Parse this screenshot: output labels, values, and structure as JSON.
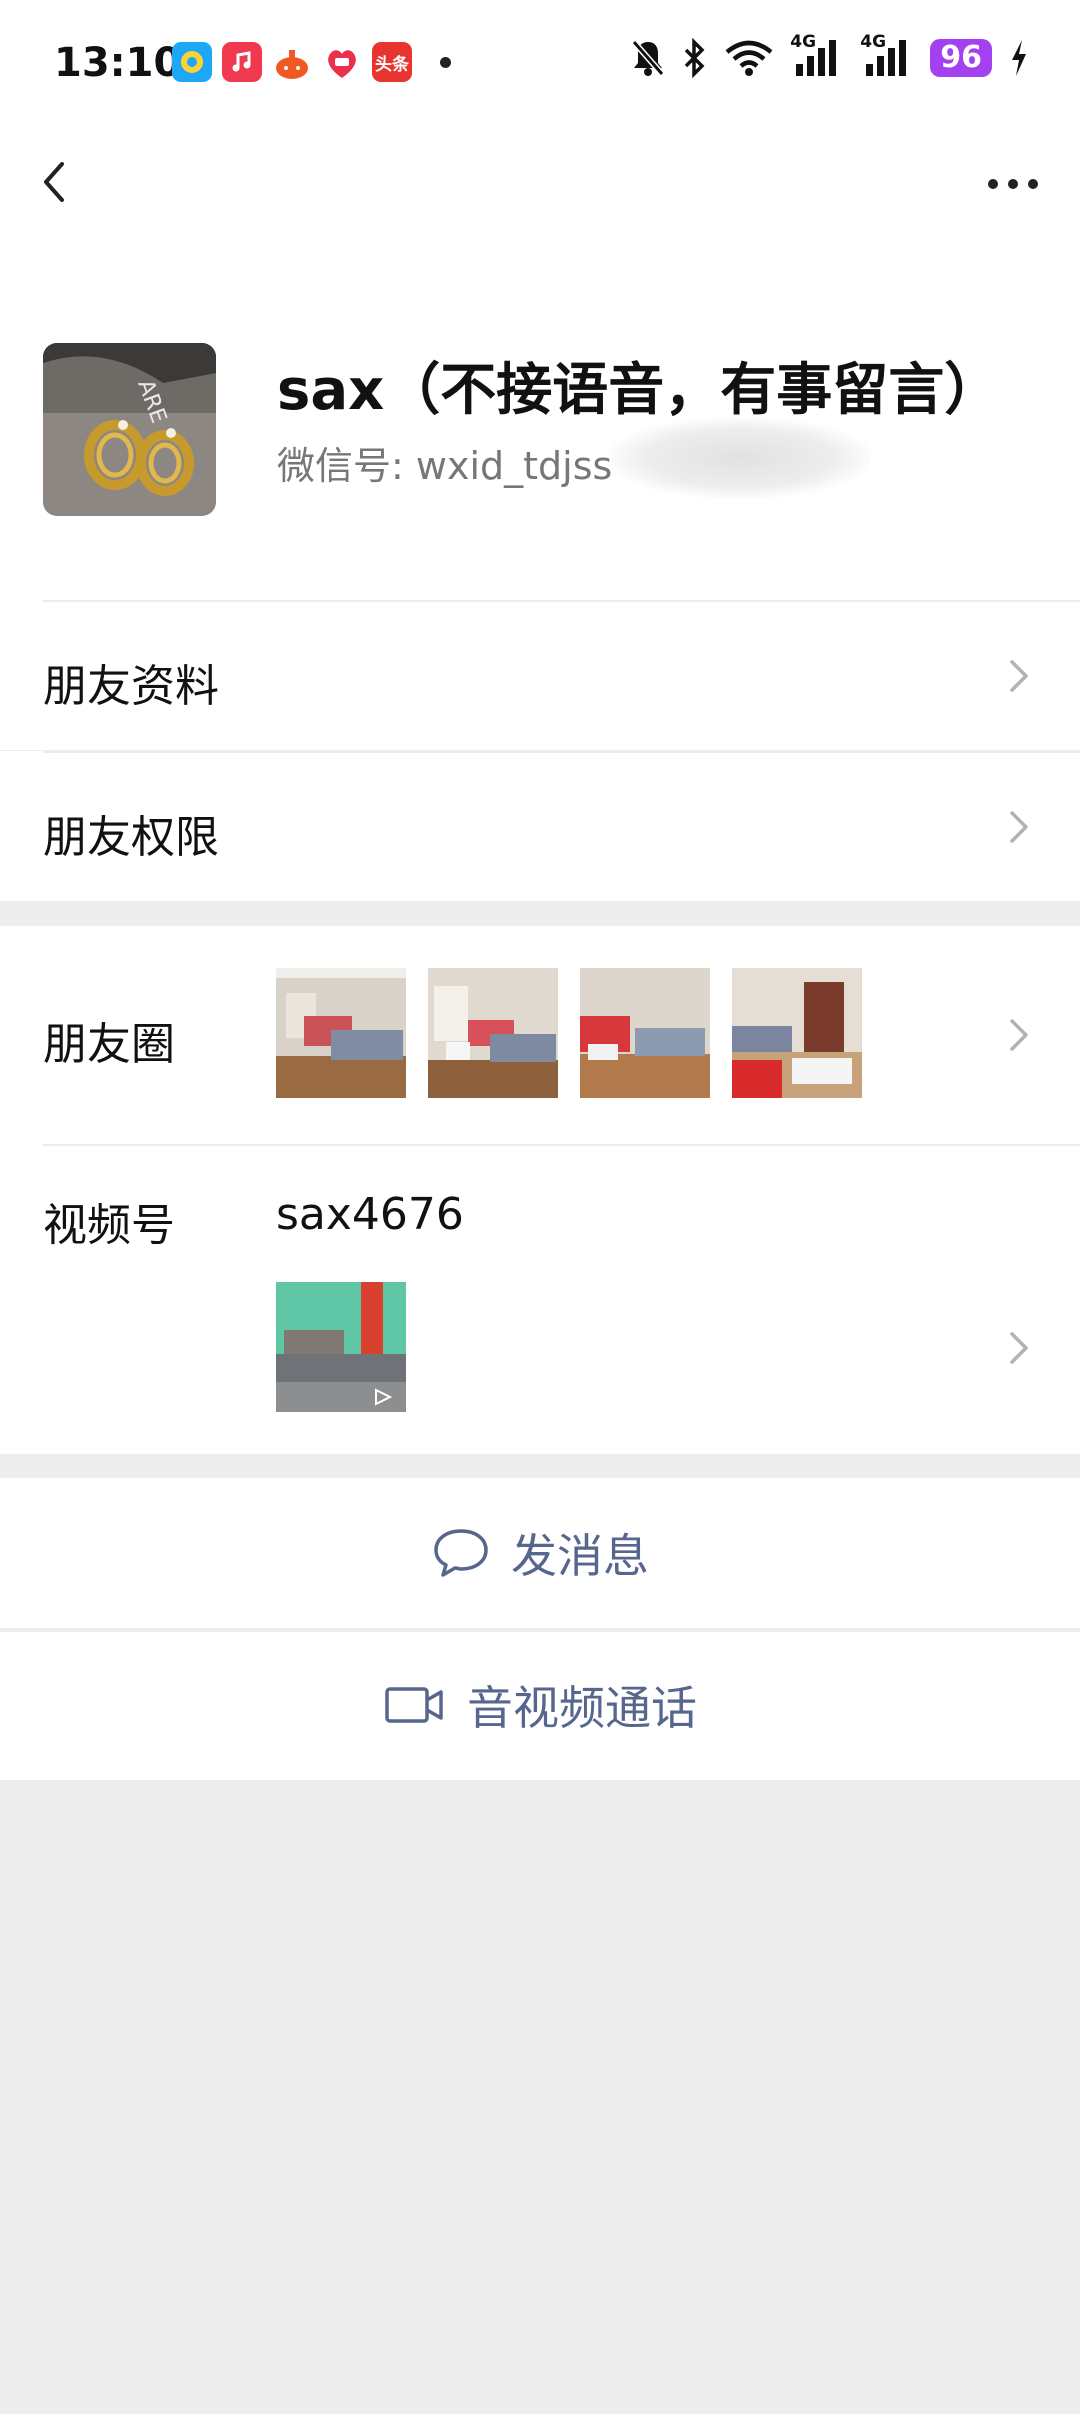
{
  "status_bar": {
    "time": "13:10",
    "battery": "96",
    "net1": "4G",
    "net2": "4G",
    "app_icons": [
      "qq-browser-icon",
      "music-icon",
      "gift-icon",
      "taobao-icon",
      "toutiao-icon"
    ],
    "toutiao_label": "头条"
  },
  "navbar": {
    "back_icon": "chevron-left-icon",
    "more_icon": "more-horizontal-icon"
  },
  "profile": {
    "name": "sax（不接语音，有事留言）",
    "wechat_id_label": "微信号:",
    "wechat_id_partial": "wxid_tdjss"
  },
  "menu": {
    "friend_profile": "朋友资料",
    "friend_permissions": "朋友权限",
    "moments": "朋友圈",
    "channels": "视频号",
    "channels_id": "sax4676"
  },
  "actions": {
    "message": "发消息",
    "video_call": "音视频通话"
  },
  "colors": {
    "background": "#ededed",
    "action_text": "#56668c",
    "battery": "#a341f0"
  }
}
